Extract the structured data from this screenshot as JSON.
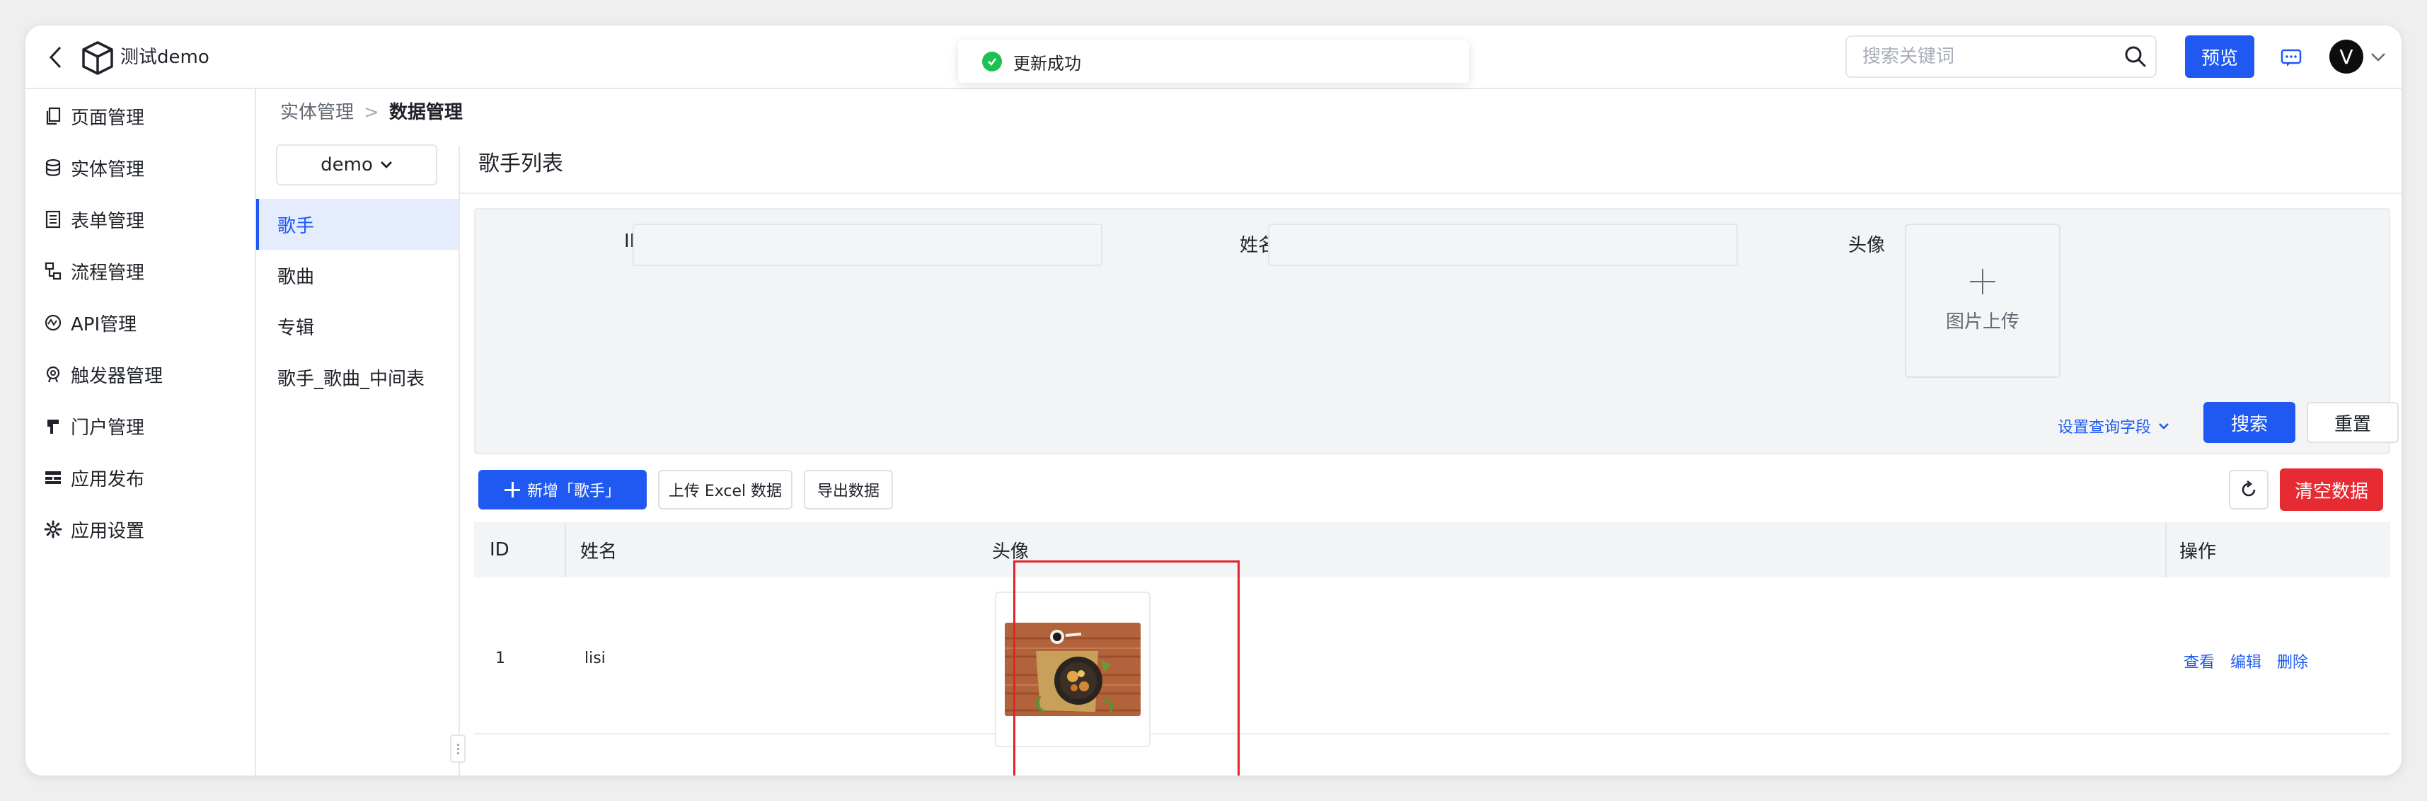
{
  "header": {
    "app_title": "测试demo",
    "search_placeholder": "搜索关键词",
    "preview_label": "预览",
    "avatar_initial": "V"
  },
  "toast": {
    "message": "更新成功"
  },
  "nav": {
    "items": [
      {
        "label": "页面管理",
        "icon": "page-icon"
      },
      {
        "label": "实体管理",
        "icon": "database-icon"
      },
      {
        "label": "表单管理",
        "icon": "form-icon"
      },
      {
        "label": "流程管理",
        "icon": "flow-icon"
      },
      {
        "label": "API管理",
        "icon": "api-icon"
      },
      {
        "label": "触发器管理",
        "icon": "trigger-icon"
      },
      {
        "label": "门户管理",
        "icon": "portal-icon"
      },
      {
        "label": "应用发布",
        "icon": "publish-icon"
      },
      {
        "label": "应用设置",
        "icon": "gear-icon"
      }
    ]
  },
  "breadcrumb": {
    "parent": "实体管理",
    "separator": ">",
    "current": "数据管理"
  },
  "db_select": {
    "value": "demo"
  },
  "entities": [
    {
      "label": "歌手",
      "active": true
    },
    {
      "label": "歌曲",
      "active": false
    },
    {
      "label": "专辑",
      "active": false
    },
    {
      "label": "歌手_歌曲_中间表",
      "active": false
    }
  ],
  "panel": {
    "title": "歌手列表"
  },
  "filters": {
    "id_label": "ID",
    "name_label": "姓名",
    "avatar_label": "头像",
    "upload_text": "图片上传",
    "query_fields_link": "设置查询字段",
    "search_button": "搜索",
    "reset_button": "重置"
  },
  "toolbar": {
    "add_button": "新增「歌手」",
    "upload_excel_button": "上传 Excel 数据",
    "export_button": "导出数据",
    "clear_button": "清空数据"
  },
  "table": {
    "columns": [
      "ID",
      "姓名",
      "头像",
      "操作"
    ],
    "rows": [
      {
        "id": "1",
        "name": "lisi",
        "actions": [
          "查看",
          "编辑",
          "删除"
        ]
      }
    ]
  },
  "colors": {
    "primary": "#1f59f2",
    "danger": "#e62b33",
    "success": "#1ec051",
    "highlight": "#e2222c"
  }
}
